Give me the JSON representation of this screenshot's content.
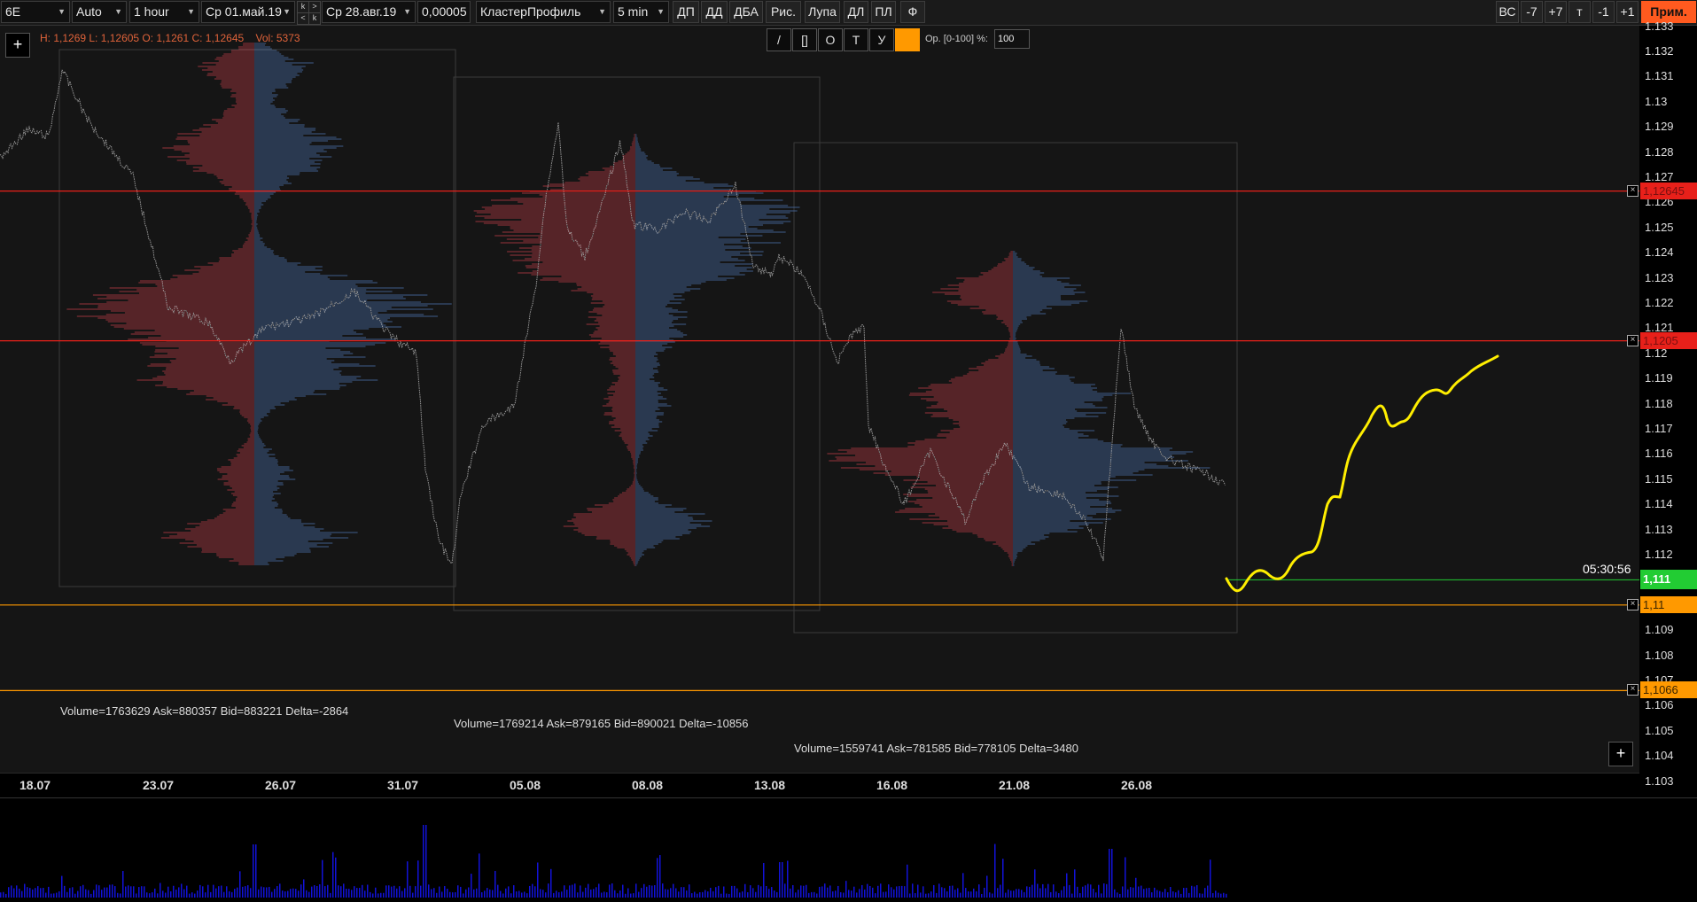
{
  "toolbar": {
    "symbol": "6E",
    "scale": "Auto",
    "timeframe": "1 hour",
    "date_from": "Ср 01.май.19",
    "date_to": "Ср 28.авг.19",
    "tick_size": "0,00005",
    "profile_type": "КластерПрофиль",
    "profile_period": "5 min",
    "buttons": [
      "ДП",
      "ДД",
      "ДБА",
      "Рис.",
      "Лупа",
      "ДЛ",
      "ПЛ",
      "Ф"
    ],
    "nav_glyphs": [
      "k",
      ">",
      "<",
      "k"
    ],
    "right_buttons": [
      "ВС",
      "-7",
      "+7",
      "т",
      "-1",
      "+1"
    ],
    "apply_label": "Прим."
  },
  "chart": {
    "ohlc_info": "H: 1,1269 L: 1,12605 O: 1,1261 C: 1,12645",
    "vol_info": "Vol: 5373",
    "plus_label": "+",
    "draw_tools": [
      "/",
      "[]",
      "O",
      "T",
      "У"
    ],
    "active_color": "#ff9900",
    "opacity_label": "Ор. [0-100] %:",
    "opacity_value": "100",
    "profile_stats": [
      "Volume=1763629  Ask=880357  Bid=883221  Delta=-2864",
      "Volume=1769214  Ask=879165  Bid=890021  Delta=-10856",
      "Volume=1559741  Ask=781585  Bid=778105  Delta=3480"
    ],
    "countdown": "05:30:56",
    "dates": [
      "18.07",
      "23.07",
      "26.07",
      "31.07",
      "05.08",
      "08.08",
      "13.08",
      "16.08",
      "21.08",
      "26.08"
    ],
    "price_ticks": [
      "1.133",
      "1.132",
      "1.131",
      "1.13",
      "1.129",
      "1.128",
      "1.127",
      "1.126",
      "1.125",
      "1.124",
      "1.123",
      "1.122",
      "1.121",
      "1.12",
      "1.119",
      "1.118",
      "1.117",
      "1.116",
      "1.115",
      "1.114",
      "1.113",
      "1.112",
      "1.111",
      "1.11",
      "1.109",
      "1.108",
      "1.107",
      "1.106",
      "1.105",
      "1.104",
      "1.103"
    ],
    "levels": [
      {
        "label": "1,12645",
        "price": 1.12645,
        "color": "#e8201a"
      },
      {
        "label": "1,1205",
        "price": 1.1205,
        "color": "#e8201a"
      },
      {
        "label": "1,11",
        "price": 1.11,
        "color": "#ff9900"
      },
      {
        "label": "1,1066",
        "price": 1.1066,
        "color": "#ff9900"
      }
    ],
    "current_price": {
      "label": "1,111",
      "price": 1.111,
      "color": "#22cc33"
    },
    "colors": {
      "ask": "#b83a45",
      "bid": "#4b6fa8",
      "projection": "#ffee00"
    }
  }
}
